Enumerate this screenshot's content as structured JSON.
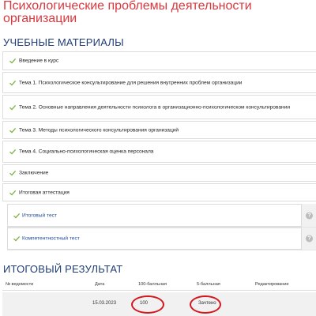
{
  "course": {
    "title": "Психологические проблемы деятельности организации"
  },
  "materials": {
    "heading": "УЧЕБНЫЕ МАТЕРИАЛЫ",
    "items": [
      {
        "label": "Введение в курс"
      },
      {
        "label": "Тема 1. Психологическое консультирование для решения внутренних проблем организации"
      },
      {
        "label": "Тема 2. Основные направления деятельности психолога в организационно-психологическом консультировании"
      },
      {
        "label": "Тема 3. Методы психологического консультирования организаций"
      },
      {
        "label": "Тема 4. Социально-психологическая оценка персонала"
      },
      {
        "label": "Заключение"
      },
      {
        "label": "Итоговая аттестация"
      }
    ],
    "sub_items": [
      {
        "label": "Итоговый тест",
        "help": "?"
      },
      {
        "label": "Компетентностный тест",
        "help": "?"
      }
    ],
    "check_color": "#7cb342"
  },
  "result": {
    "heading": "ИТОГОВЫЙ РЕЗУЛЬТАТ",
    "columns": [
      "№ ведомости",
      "Дата",
      "100-балльная",
      "5-балльная",
      "Редактирование"
    ],
    "row": {
      "statement_no": "",
      "date": "15.03.2023",
      "score_100": "100",
      "score_5": "Зачтено",
      "edit": ""
    },
    "highlight_color": "#d4161d"
  }
}
